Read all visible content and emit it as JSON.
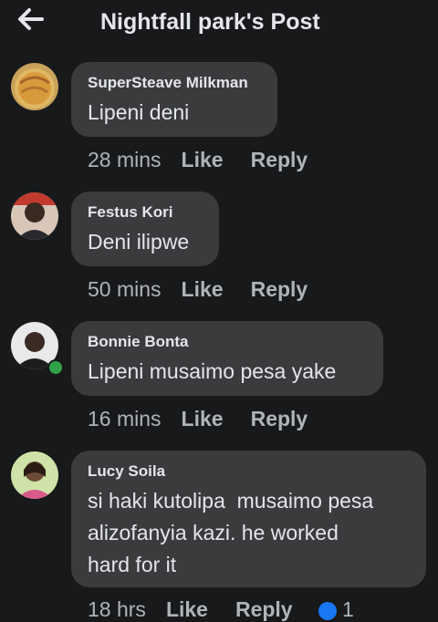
{
  "header": {
    "title": "Nightfall park's Post"
  },
  "comments": [
    {
      "author": "SuperSteave Milkman",
      "text": "Lipeni deni",
      "time": "28 mins",
      "like": "Like",
      "reply": "Reply"
    },
    {
      "author": "Festus Kori",
      "text": "Deni ilipwe",
      "time": "50 mins",
      "like": "Like",
      "reply": "Reply"
    },
    {
      "author": "Bonnie Bonta",
      "text": "Lipeni musaimo pesa yake",
      "time": "16 mins",
      "like": "Like",
      "reply": "Reply"
    },
    {
      "author": "Lucy Soila",
      "text": "si haki kutolipa  musaimo pesa\nalizofanyia kazi. he worked\nhard for it",
      "time": "18 hrs",
      "like": "Like",
      "reply": "Reply",
      "reaction_count": "1"
    }
  ],
  "colors": {
    "background": "#18191a",
    "bubble": "#3a3b3c",
    "text": "#e4e6eb",
    "muted": "#b0b3b8",
    "online": "#31a24c"
  }
}
